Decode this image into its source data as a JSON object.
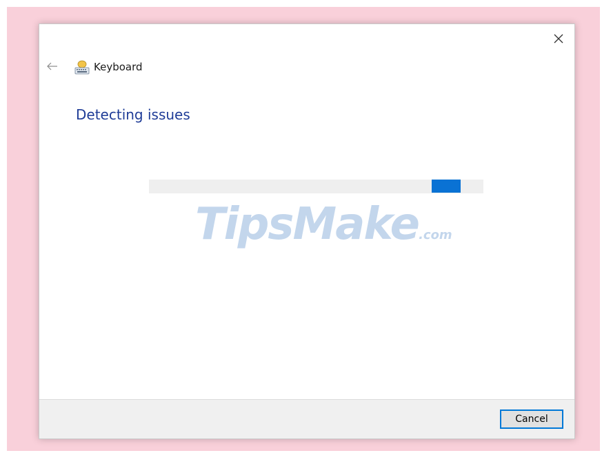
{
  "dialog": {
    "app_title": "Keyboard",
    "heading": "Detecting issues",
    "progress": {
      "state": "indeterminate",
      "chunk_position_fraction": 0.85,
      "track_color": "#efefef",
      "chunk_color": "#0a72d4"
    },
    "icons": {
      "close": "close-icon",
      "back": "back-arrow-icon",
      "app": "keyboard-icon"
    },
    "footer": {
      "cancel_label": "Cancel"
    }
  },
  "watermark": {
    "main": "TipsMake",
    "suffix": ".com"
  },
  "colors": {
    "background": "#f9d0da",
    "heading": "#1f3c97",
    "accent": "#0078d7"
  }
}
